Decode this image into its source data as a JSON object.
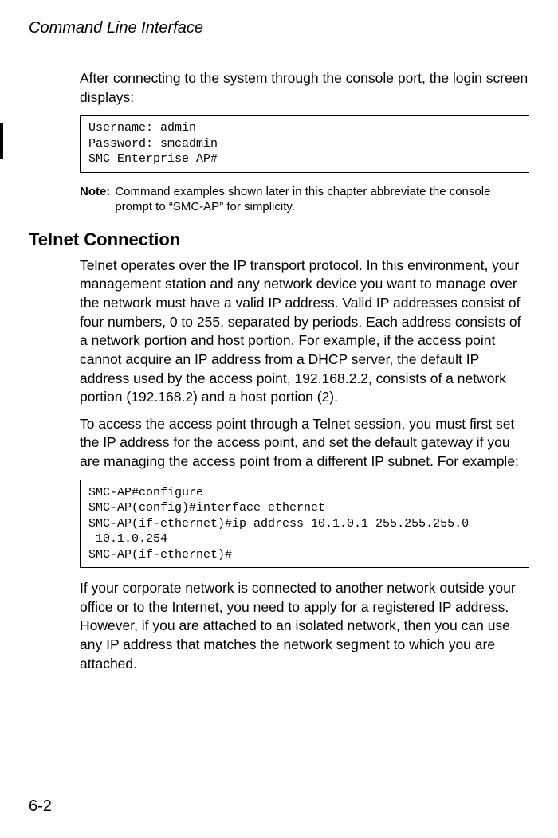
{
  "header": "Command Line Interface",
  "intro": "After connecting to the system through the console port, the login screen displays:",
  "code1": "Username: admin\nPassword: smcadmin\nSMC Enterprise AP#",
  "note_label": "Note:",
  "note_text": "Command examples shown later in this chapter abbreviate the console prompt to “SMC-AP” for simplicity.",
  "section_heading": "Telnet Connection",
  "para1": "Telnet operates over the IP transport protocol. In this environment, your management station and any network device you want to manage over the network must have a valid IP address. Valid IP addresses consist of four numbers, 0 to 255, separated by periods. Each address consists of a network portion and host portion. For example, if the access point cannot acquire an IP address from a DHCP server, the default IP address used by the access point, 192.168.2.2, consists of a network portion (192.168.2) and a host portion (2).",
  "para2": "To access the access point through a Telnet session, you must first set the IP address for the access point, and set the default gateway if you are managing the access point from a different IP subnet. For example:",
  "code2": "SMC-AP#configure\nSMC-AP(config)#interface ethernet\nSMC-AP(if-ethernet)#ip address 10.1.0.1 255.255.255.0\n 10.1.0.254\nSMC-AP(if-ethernet)#",
  "para3": "If your corporate network is connected to another network outside your office or to the Internet, you need to apply for a registered IP address. However, if you are attached to an isolated network, then you can use any IP address that matches the network segment to which you are attached.",
  "page_number": "6-2"
}
